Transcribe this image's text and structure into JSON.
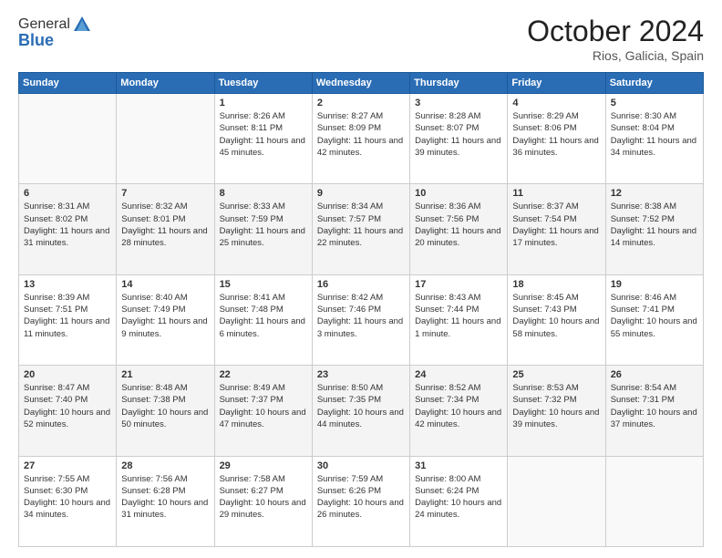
{
  "header": {
    "logo_line1": "General",
    "logo_line2": "Blue",
    "month_title": "October 2024",
    "location": "Rios, Galicia, Spain"
  },
  "weekdays": [
    "Sunday",
    "Monday",
    "Tuesday",
    "Wednesday",
    "Thursday",
    "Friday",
    "Saturday"
  ],
  "weeks": [
    [
      {
        "day": "",
        "sunrise": "",
        "sunset": "",
        "daylight": ""
      },
      {
        "day": "",
        "sunrise": "",
        "sunset": "",
        "daylight": ""
      },
      {
        "day": "1",
        "sunrise": "Sunrise: 8:26 AM",
        "sunset": "Sunset: 8:11 PM",
        "daylight": "Daylight: 11 hours and 45 minutes."
      },
      {
        "day": "2",
        "sunrise": "Sunrise: 8:27 AM",
        "sunset": "Sunset: 8:09 PM",
        "daylight": "Daylight: 11 hours and 42 minutes."
      },
      {
        "day": "3",
        "sunrise": "Sunrise: 8:28 AM",
        "sunset": "Sunset: 8:07 PM",
        "daylight": "Daylight: 11 hours and 39 minutes."
      },
      {
        "day": "4",
        "sunrise": "Sunrise: 8:29 AM",
        "sunset": "Sunset: 8:06 PM",
        "daylight": "Daylight: 11 hours and 36 minutes."
      },
      {
        "day": "5",
        "sunrise": "Sunrise: 8:30 AM",
        "sunset": "Sunset: 8:04 PM",
        "daylight": "Daylight: 11 hours and 34 minutes."
      }
    ],
    [
      {
        "day": "6",
        "sunrise": "Sunrise: 8:31 AM",
        "sunset": "Sunset: 8:02 PM",
        "daylight": "Daylight: 11 hours and 31 minutes."
      },
      {
        "day": "7",
        "sunrise": "Sunrise: 8:32 AM",
        "sunset": "Sunset: 8:01 PM",
        "daylight": "Daylight: 11 hours and 28 minutes."
      },
      {
        "day": "8",
        "sunrise": "Sunrise: 8:33 AM",
        "sunset": "Sunset: 7:59 PM",
        "daylight": "Daylight: 11 hours and 25 minutes."
      },
      {
        "day": "9",
        "sunrise": "Sunrise: 8:34 AM",
        "sunset": "Sunset: 7:57 PM",
        "daylight": "Daylight: 11 hours and 22 minutes."
      },
      {
        "day": "10",
        "sunrise": "Sunrise: 8:36 AM",
        "sunset": "Sunset: 7:56 PM",
        "daylight": "Daylight: 11 hours and 20 minutes."
      },
      {
        "day": "11",
        "sunrise": "Sunrise: 8:37 AM",
        "sunset": "Sunset: 7:54 PM",
        "daylight": "Daylight: 11 hours and 17 minutes."
      },
      {
        "day": "12",
        "sunrise": "Sunrise: 8:38 AM",
        "sunset": "Sunset: 7:52 PM",
        "daylight": "Daylight: 11 hours and 14 minutes."
      }
    ],
    [
      {
        "day": "13",
        "sunrise": "Sunrise: 8:39 AM",
        "sunset": "Sunset: 7:51 PM",
        "daylight": "Daylight: 11 hours and 11 minutes."
      },
      {
        "day": "14",
        "sunrise": "Sunrise: 8:40 AM",
        "sunset": "Sunset: 7:49 PM",
        "daylight": "Daylight: 11 hours and 9 minutes."
      },
      {
        "day": "15",
        "sunrise": "Sunrise: 8:41 AM",
        "sunset": "Sunset: 7:48 PM",
        "daylight": "Daylight: 11 hours and 6 minutes."
      },
      {
        "day": "16",
        "sunrise": "Sunrise: 8:42 AM",
        "sunset": "Sunset: 7:46 PM",
        "daylight": "Daylight: 11 hours and 3 minutes."
      },
      {
        "day": "17",
        "sunrise": "Sunrise: 8:43 AM",
        "sunset": "Sunset: 7:44 PM",
        "daylight": "Daylight: 11 hours and 1 minute."
      },
      {
        "day": "18",
        "sunrise": "Sunrise: 8:45 AM",
        "sunset": "Sunset: 7:43 PM",
        "daylight": "Daylight: 10 hours and 58 minutes."
      },
      {
        "day": "19",
        "sunrise": "Sunrise: 8:46 AM",
        "sunset": "Sunset: 7:41 PM",
        "daylight": "Daylight: 10 hours and 55 minutes."
      }
    ],
    [
      {
        "day": "20",
        "sunrise": "Sunrise: 8:47 AM",
        "sunset": "Sunset: 7:40 PM",
        "daylight": "Daylight: 10 hours and 52 minutes."
      },
      {
        "day": "21",
        "sunrise": "Sunrise: 8:48 AM",
        "sunset": "Sunset: 7:38 PM",
        "daylight": "Daylight: 10 hours and 50 minutes."
      },
      {
        "day": "22",
        "sunrise": "Sunrise: 8:49 AM",
        "sunset": "Sunset: 7:37 PM",
        "daylight": "Daylight: 10 hours and 47 minutes."
      },
      {
        "day": "23",
        "sunrise": "Sunrise: 8:50 AM",
        "sunset": "Sunset: 7:35 PM",
        "daylight": "Daylight: 10 hours and 44 minutes."
      },
      {
        "day": "24",
        "sunrise": "Sunrise: 8:52 AM",
        "sunset": "Sunset: 7:34 PM",
        "daylight": "Daylight: 10 hours and 42 minutes."
      },
      {
        "day": "25",
        "sunrise": "Sunrise: 8:53 AM",
        "sunset": "Sunset: 7:32 PM",
        "daylight": "Daylight: 10 hours and 39 minutes."
      },
      {
        "day": "26",
        "sunrise": "Sunrise: 8:54 AM",
        "sunset": "Sunset: 7:31 PM",
        "daylight": "Daylight: 10 hours and 37 minutes."
      }
    ],
    [
      {
        "day": "27",
        "sunrise": "Sunrise: 7:55 AM",
        "sunset": "Sunset: 6:30 PM",
        "daylight": "Daylight: 10 hours and 34 minutes."
      },
      {
        "day": "28",
        "sunrise": "Sunrise: 7:56 AM",
        "sunset": "Sunset: 6:28 PM",
        "daylight": "Daylight: 10 hours and 31 minutes."
      },
      {
        "day": "29",
        "sunrise": "Sunrise: 7:58 AM",
        "sunset": "Sunset: 6:27 PM",
        "daylight": "Daylight: 10 hours and 29 minutes."
      },
      {
        "day": "30",
        "sunrise": "Sunrise: 7:59 AM",
        "sunset": "Sunset: 6:26 PM",
        "daylight": "Daylight: 10 hours and 26 minutes."
      },
      {
        "day": "31",
        "sunrise": "Sunrise: 8:00 AM",
        "sunset": "Sunset: 6:24 PM",
        "daylight": "Daylight: 10 hours and 24 minutes."
      },
      {
        "day": "",
        "sunrise": "",
        "sunset": "",
        "daylight": ""
      },
      {
        "day": "",
        "sunrise": "",
        "sunset": "",
        "daylight": ""
      }
    ]
  ]
}
